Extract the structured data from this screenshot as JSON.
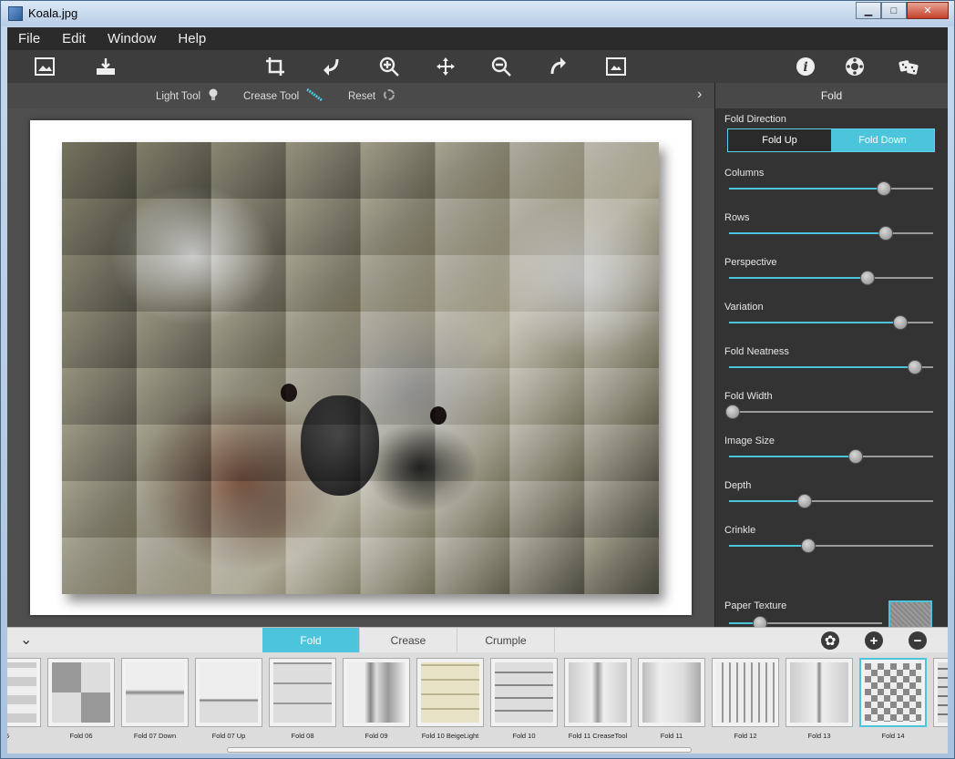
{
  "window": {
    "title": "Koala.jpg",
    "buttons": [
      "minimize",
      "maximize",
      "close"
    ]
  },
  "menu": [
    "File",
    "Edit",
    "Window",
    "Help"
  ],
  "toolbar": {
    "icons": [
      "open-image-icon",
      "save-icon",
      "crop-icon",
      "undo-icon",
      "zoom-in-icon",
      "move-icon",
      "zoom-out-icon",
      "redo-icon",
      "fit-image-icon",
      "info-icon",
      "settings-icon",
      "random-dice-icon"
    ]
  },
  "subtoolbar": {
    "light_tool": "Light Tool",
    "crease_tool": "Crease Tool",
    "reset": "Reset"
  },
  "panel": {
    "title": "Fold",
    "fold_direction_label": "Fold Direction",
    "fold_up": "Fold Up",
    "fold_down": "Fold Down",
    "active_direction": "Fold Down",
    "sliders": [
      {
        "label": "Columns",
        "value": 0.76
      },
      {
        "label": "Rows",
        "value": 0.77
      },
      {
        "label": "Perspective",
        "value": 0.68
      },
      {
        "label": "Variation",
        "value": 0.84
      },
      {
        "label": "Fold Neatness",
        "value": 0.91
      },
      {
        "label": "Fold Width",
        "value": 0.02
      },
      {
        "label": "Image Size",
        "value": 0.62
      },
      {
        "label": "Depth",
        "value": 0.37
      },
      {
        "label": "Crinkle",
        "value": 0.39
      }
    ],
    "paper_texture_label": "Paper Texture",
    "paper_texture_value": 0.2
  },
  "bottom_tabs": [
    "Fold",
    "Crease",
    "Crumple"
  ],
  "active_tab": "Fold",
  "thumbnails": [
    {
      "label": "5"
    },
    {
      "label": "Fold 06"
    },
    {
      "label": "Fold 07 Down"
    },
    {
      "label": "Fold 07 Up"
    },
    {
      "label": "Fold 08"
    },
    {
      "label": "Fold 09"
    },
    {
      "label": "Fold 10 BeigeLight"
    },
    {
      "label": "Fold 10"
    },
    {
      "label": "Fold 11 CreaseTool"
    },
    {
      "label": "Fold 11"
    },
    {
      "label": "Fold 12"
    },
    {
      "label": "Fold 13"
    },
    {
      "label": "Fold 14"
    },
    {
      "label": ""
    }
  ],
  "selected_thumbnail": "Fold 14",
  "colors": {
    "accent": "#4cc4dc",
    "panel_bg": "#333333",
    "canvas_bg": "#4e4e4e"
  }
}
